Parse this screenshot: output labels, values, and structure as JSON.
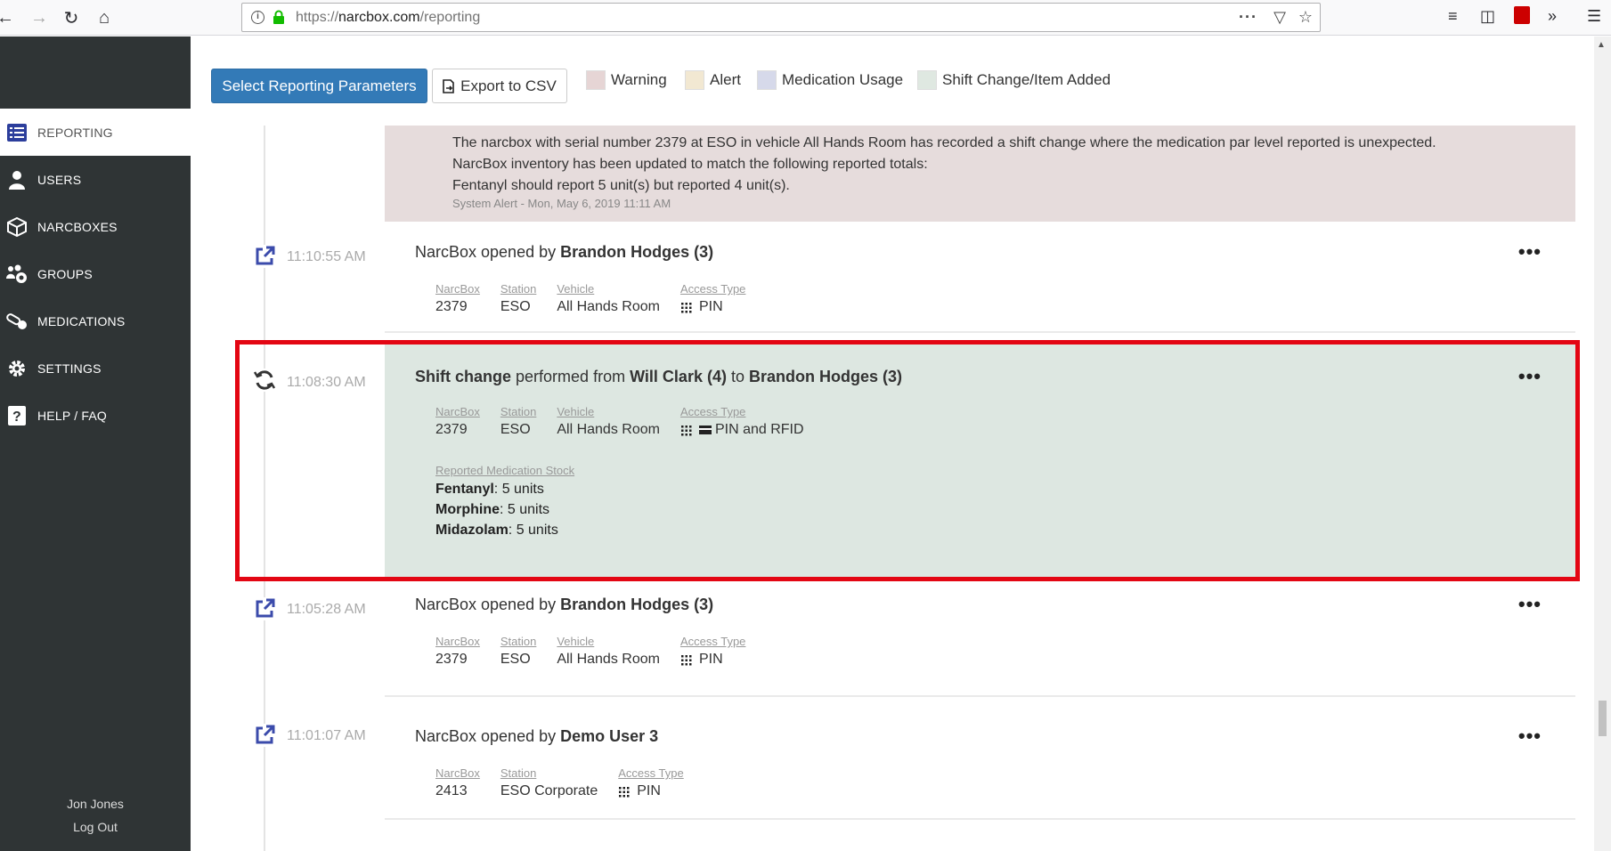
{
  "browser": {
    "url_prefix": "https://",
    "url_host": "narcbox.com",
    "url_path": "/reporting"
  },
  "sidebar": {
    "items": [
      {
        "label": "REPORTING",
        "icon": "list-icon",
        "active": true
      },
      {
        "label": "USERS",
        "icon": "user-icon"
      },
      {
        "label": "NARCBOXES",
        "icon": "box-icon"
      },
      {
        "label": "GROUPS",
        "icon": "group-icon"
      },
      {
        "label": "MEDICATIONS",
        "icon": "pill-icon"
      },
      {
        "label": "SETTINGS",
        "icon": "gear-icon"
      },
      {
        "label": "HELP / FAQ",
        "icon": "help-icon"
      }
    ],
    "user_name": "Jon Jones",
    "logout": "Log Out"
  },
  "toolbar": {
    "select_params": "Select Reporting Parameters",
    "export_csv": "Export to CSV"
  },
  "legend": [
    {
      "label": "Warning",
      "color": "#e6d5d5"
    },
    {
      "label": "Alert",
      "color": "#f2e8d2"
    },
    {
      "label": "Medication Usage",
      "color": "#d6d9ea"
    },
    {
      "label": "Shift Change/Item Added",
      "color": "#dfe8e1"
    }
  ],
  "colors": {
    "alert_bg": "#e6dcdc",
    "shift_bg": "#dde7e1",
    "primary": "#337ab7",
    "highlight": "#e30613"
  },
  "alert_entry": {
    "line1": "The narcbox with serial number 2379 at ESO in vehicle All Hands Room has recorded a shift change where the medication par level reported is unexpected.",
    "line2": "NarcBox inventory has been updated to match the following reported totals:",
    "line3": "Fentanyl should report 5 unit(s) but reported 4 unit(s).",
    "meta": "System Alert - Mon, May 6, 2019 11:11 AM"
  },
  "labels": {
    "narcbox": "NarcBox",
    "station": "Station",
    "vehicle": "Vehicle",
    "access_type": "Access Type",
    "reported_stock": "Reported Medication Stock",
    "opened_by": "NarcBox opened by",
    "shift_change": "Shift change",
    "performed_from": "performed from",
    "to": "to",
    "more": "•••"
  },
  "entries": [
    {
      "time": "11:10:55 AM",
      "user": "Brandon Hodges (3)",
      "narcbox": "2379",
      "station": "ESO",
      "vehicle": "All Hands Room",
      "access": "PIN"
    },
    {
      "time": "11:08:30 AM",
      "from_user": "Will Clark (4)",
      "to_user": "Brandon Hodges (3)",
      "narcbox": "2379",
      "station": "ESO",
      "vehicle": "All Hands Room",
      "access": "PIN and RFID",
      "stock": [
        {
          "name": "Fentanyl",
          "qty": ": 5 units"
        },
        {
          "name": "Morphine",
          "qty": ": 5 units"
        },
        {
          "name": "Midazolam",
          "qty": ": 5 units"
        }
      ]
    },
    {
      "time": "11:05:28 AM",
      "user": "Brandon Hodges (3)",
      "narcbox": "2379",
      "station": "ESO",
      "vehicle": "All Hands Room",
      "access": "PIN"
    },
    {
      "time": "11:01:07 AM",
      "user": "Demo User 3",
      "narcbox": "2413",
      "station": "ESO Corporate",
      "access": "PIN"
    }
  ]
}
